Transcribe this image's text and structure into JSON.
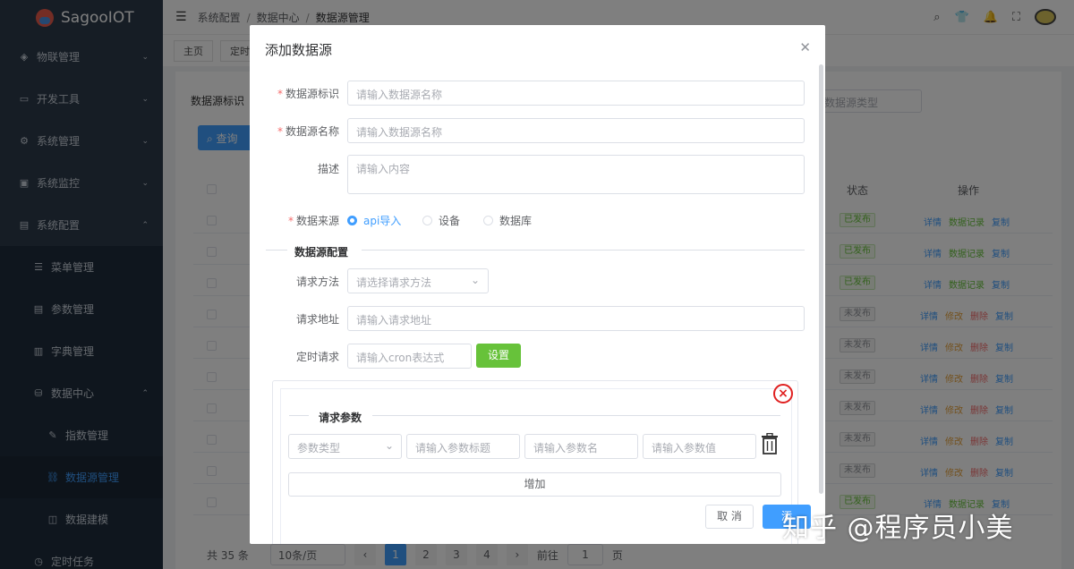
{
  "app": {
    "title": "SagooIOT"
  },
  "sidebar": {
    "items": [
      {
        "label": "物联管理",
        "icon": "cube-icon",
        "expanded": false
      },
      {
        "label": "开发工具",
        "icon": "laptop-icon",
        "expanded": false
      },
      {
        "label": "系统管理",
        "icon": "gear-icon",
        "expanded": false
      },
      {
        "label": "系统监控",
        "icon": "monitor-icon",
        "expanded": false
      },
      {
        "label": "系统配置",
        "icon": "document-icon",
        "expanded": true
      }
    ],
    "config_children": [
      {
        "label": "菜单管理",
        "icon": "menu-icon"
      },
      {
        "label": "参数管理",
        "icon": "doc-icon"
      },
      {
        "label": "字典管理",
        "icon": "book-icon"
      },
      {
        "label": "数据中心",
        "icon": "database-icon",
        "expanded": true
      }
    ],
    "datacenter_children": [
      {
        "label": "指数管理",
        "icon": "pen-icon"
      },
      {
        "label": "数据源管理",
        "icon": "link-icon",
        "active": true
      },
      {
        "label": "数据建模",
        "icon": "model-icon"
      }
    ],
    "partial_item": {
      "label": "定时任务"
    }
  },
  "header": {
    "breadcrumb": [
      "系统配置",
      "数据中心",
      "数据源管理"
    ],
    "separator": "/"
  },
  "tabs": [
    "主页",
    "定时"
  ],
  "page": {
    "filter_label": "数据源标识",
    "type_select_placeholder": "数据源类型",
    "query_button": "查询",
    "columns": {
      "status": "状态",
      "actions": "操作"
    },
    "rows": [
      {
        "status": "已发布",
        "published": true,
        "actions": [
          "详情",
          "数据记录",
          "复制"
        ]
      },
      {
        "status": "已发布",
        "published": true,
        "actions": [
          "详情",
          "数据记录",
          "复制"
        ]
      },
      {
        "status": "已发布",
        "published": true,
        "actions": [
          "详情",
          "数据记录",
          "复制"
        ]
      },
      {
        "status": "未发布",
        "published": false,
        "actions": [
          "详情",
          "修改",
          "删除",
          "复制"
        ]
      },
      {
        "status": "未发布",
        "published": false,
        "actions": [
          "详情",
          "修改",
          "删除",
          "复制"
        ]
      },
      {
        "status": "未发布",
        "published": false,
        "actions": [
          "详情",
          "修改",
          "删除",
          "复制"
        ]
      },
      {
        "status": "未发布",
        "published": false,
        "actions": [
          "详情",
          "修改",
          "删除",
          "复制"
        ]
      },
      {
        "status": "未发布",
        "published": false,
        "actions": [
          "详情",
          "修改",
          "删除",
          "复制"
        ]
      },
      {
        "status": "未发布",
        "published": false,
        "actions": [
          "详情",
          "修改",
          "删除",
          "复制"
        ]
      },
      {
        "status": "已发布",
        "published": true,
        "actions": [
          "详情",
          "数据记录",
          "复制"
        ]
      }
    ],
    "pagination": {
      "total": "共 35 条",
      "page_size": "10条/页",
      "pages": [
        "1",
        "2",
        "3",
        "4"
      ],
      "current": "1",
      "goto_label": "前往",
      "goto_value": "1",
      "page_suffix": "页"
    }
  },
  "dialog": {
    "title": "添加数据源",
    "fields": {
      "key": {
        "label": "数据源标识",
        "placeholder": "请输入数据源名称",
        "required": true
      },
      "name": {
        "label": "数据源名称",
        "placeholder": "请输入数据源名称",
        "required": true
      },
      "desc": {
        "label": "描述",
        "placeholder": "请输入内容"
      },
      "source": {
        "label": "数据来源",
        "required": true,
        "options": [
          "api导入",
          "设备",
          "数据库"
        ],
        "selected": "api导入"
      }
    },
    "config_section": "数据源配置",
    "method": {
      "label": "请求方法",
      "placeholder": "请选择请求方法"
    },
    "url": {
      "label": "请求地址",
      "placeholder": "请输入请求地址"
    },
    "cron": {
      "label": "定时请求",
      "placeholder": "请输入cron表达式",
      "button": "设置"
    },
    "params": {
      "section": "请求参数",
      "type_placeholder": "参数类型",
      "title_placeholder": "请输入参数标题",
      "name_placeholder": "请输入参数名",
      "value_placeholder": "请输入参数值",
      "add_button": "增加"
    },
    "footer": {
      "cancel": "取 消",
      "ok": "添"
    }
  },
  "watermark": "知乎 @程序员小美"
}
